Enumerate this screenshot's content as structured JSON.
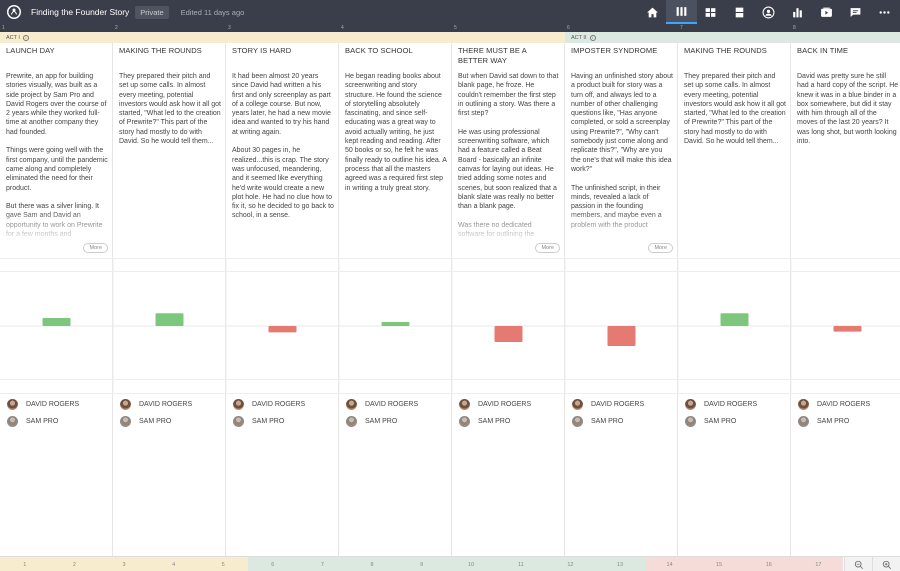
{
  "header": {
    "title": "Finding the Founder Story",
    "privacy": "Private",
    "edited": "Edited 11 days ago",
    "nav_icons": [
      "home-icon",
      "columns-icon",
      "grid-icon",
      "panel-icon",
      "person-icon",
      "bar-chart-icon",
      "media-icon",
      "comment-icon",
      "more-icon"
    ],
    "active_icon": "columns-icon"
  },
  "column_numbers": [
    "1",
    "2",
    "3",
    "4",
    "5",
    "6",
    "7",
    "8"
  ],
  "acts": [
    {
      "label": "ACT I",
      "color": "#f8eccf"
    },
    {
      "label": "ACT II",
      "color": "#dbe9e1"
    }
  ],
  "columns": [
    {
      "title": "LAUNCH DAY",
      "body": "Prewrite, an app for building stories visually, was built as a side project by Sam Pro and David Rogers over the course of 2 years while they worked full-time at another company they had founded.\n\nThings were going well with the first company, until the pandemic came along and completely eliminated the need for their product.\n\nBut there was a silver lining. It gave Sam and David an opportunity to work on Prewrite for a few months and",
      "more": "More"
    },
    {
      "title": "MAKING THE ROUNDS",
      "body": "They prepared their pitch and set up some calls. In almost every meeting, potential investors would ask how it all got started, \"What led to the creation of Prewrite?\" This part of the story had mostly to do with David. So he would tell them...",
      "more": ""
    },
    {
      "title": "STORY IS HARD",
      "body": "It had been almost 20 years since David had written a his first and only screenplay as part of a college course. But now, years later, he had a new movie idea and wanted to try his hand at writing again.\n\nAbout 30 pages in, he realized...this is crap. The story was unfocused, meandering, and it seemed like everything he'd write would create a new plot hole. He had no clue how to fix it, so he decided to go back to school, in a sense.",
      "more": ""
    },
    {
      "title": "BACK TO SCHOOL",
      "body": "He began reading books about screenwriting and story structure. He found the science of storytelling absolutely fascinating, and since self-educating was a great way to avoid actually writing, he just kept reading and reading. After 50 books or so, he felt he was finally ready to outline his idea. A process that all the masters agreed was a required first step in writing a truly great story.",
      "more": ""
    },
    {
      "title": "THERE MUST BE A BETTER WAY",
      "body": "But when David sat down to that blank page, he froze. He couldn't remember the first step in outlining a story. Was there a first step?\n\nHe was using professional screenwriting software, which had a feature called a Beat Board - basically an infinite canvas for laying out ideas. He tried adding some notes and scenes, but soon realized that a blank slate was really no better than a blank page.\n\nWas there no dedicated software for outlining the",
      "more": "More"
    },
    {
      "title": "IMPOSTER SYNDROME",
      "body": "Having an unfinished story about a product built for story was a turn off, and always led to a number of other challenging questions like, \"Has anyone completed, or sold a screenplay using Prewrite?\", \"Why can't somebody just come along and replicate this?\", \"Why are you the one's that will make this idea work?\"\n\nThe unfinished script, in their minds, revealed a lack of passion in the founding members, and maybe even a problem with the product",
      "more": "More"
    },
    {
      "title": "MAKING THE ROUNDS",
      "body": "They prepared their pitch and set up some calls. In almost every meeting, potential investors would ask how it all got started, \"What led to the creation of Prewrite?\" This part of the story had mostly to do with David. So he would tell them...",
      "more": ""
    },
    {
      "title": "BACK IN TIME",
      "body": "David was pretty sure he still had a hard copy of the script. He knew it was in a blue binder in a box somewhere, but did it stay with him through all of the moves of the last 20 years? It was long shot, but worth looking into.",
      "more": ""
    }
  ],
  "chart_data": {
    "type": "bar",
    "categories": [
      "1",
      "2",
      "3",
      "4",
      "5",
      "6",
      "7",
      "8"
    ],
    "values": [
      1.0,
      1.6,
      -0.8,
      0.5,
      -2.0,
      -2.5,
      1.6,
      -0.7
    ],
    "ylim": [
      -3,
      3
    ],
    "positive_color": "#7dc77d",
    "negative_color": "#e47a72"
  },
  "characters": [
    {
      "name": "DAVID ROGERS",
      "avatar": "david-avatar"
    },
    {
      "name": "SAM PRO",
      "avatar": "sam-avatar"
    }
  ],
  "scene_numbers": [
    "1",
    "2",
    "3",
    "4",
    "5",
    "6",
    "7",
    "8",
    "9",
    "10",
    "11",
    "12",
    "13",
    "14",
    "15",
    "16",
    "17"
  ],
  "scene_colors": {
    "act1": "#f8eccf",
    "act2": "#dbe9e1",
    "act3": "#f5dcd8"
  }
}
